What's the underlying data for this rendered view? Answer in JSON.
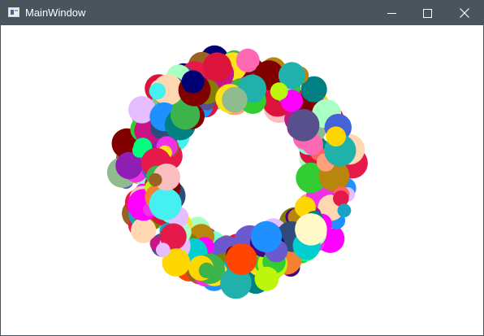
{
  "window": {
    "title": "MainWindow",
    "titlebar_color": "#4a545c",
    "background": "#ffffff"
  },
  "controls": {
    "minimize_icon": "minimize-icon",
    "maximize_icon": "maximize-icon",
    "close_icon": "close-icon"
  },
  "canvas": {
    "shape": "random colored circles arranged in a ring",
    "palette": [
      "#e6194b",
      "#3cb44b",
      "#ffe119",
      "#4363d8",
      "#f58231",
      "#911eb4",
      "#46f0f0",
      "#f032e6",
      "#bcf60c",
      "#fabebe",
      "#008080",
      "#e6beff",
      "#9a6324",
      "#fffac8",
      "#800000",
      "#aaffc3",
      "#808000",
      "#ffd8b1",
      "#000075",
      "#1ba3c6",
      "#2f4b7c",
      "#ff6361",
      "#58508d",
      "#ff00ff",
      "#00ced1",
      "#7fffd4",
      "#32cd32",
      "#ff4500",
      "#6a5acd",
      "#20b2aa",
      "#ffd700",
      "#dc143c",
      "#8fbc8f",
      "#b8860b",
      "#1e90ff",
      "#ff69b4",
      "#00ff7f",
      "#c71585",
      "#4b0082",
      "#ffa07a"
    ]
  }
}
